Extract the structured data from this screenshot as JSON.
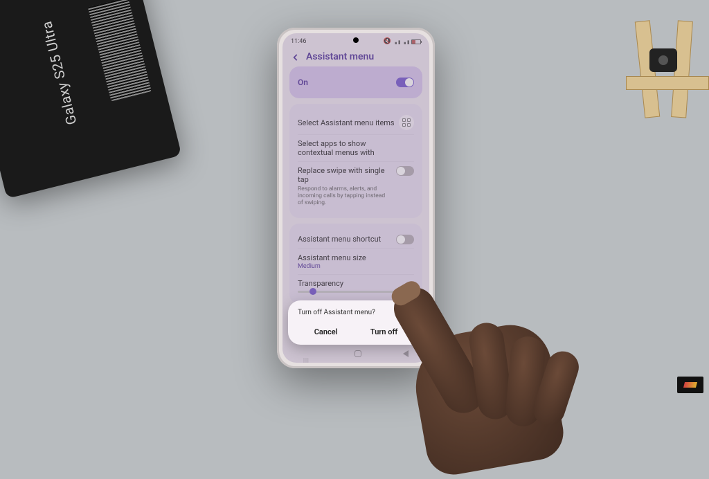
{
  "product_box": {
    "label": "Galaxy S25 Ultra"
  },
  "status": {
    "time": "11:46"
  },
  "header": {
    "title": "Assistant menu"
  },
  "card_main": {
    "state_label": "On"
  },
  "card_items": {
    "select_items": "Select Assistant menu items",
    "select_apps": "Select apps to show contextual menus with",
    "replace_swipe_title": "Replace swipe with single tap",
    "replace_swipe_desc": "Respond to alarms, alerts, and incoming calls by tapping instead of swiping."
  },
  "card_options": {
    "shortcut": "Assistant menu shortcut",
    "size_label": "Assistant menu size",
    "size_value": "Medium",
    "transparency": "Transparency"
  },
  "dialog": {
    "title": "Turn off Assistant menu?",
    "cancel": "Cancel",
    "confirm": "Turn off"
  }
}
